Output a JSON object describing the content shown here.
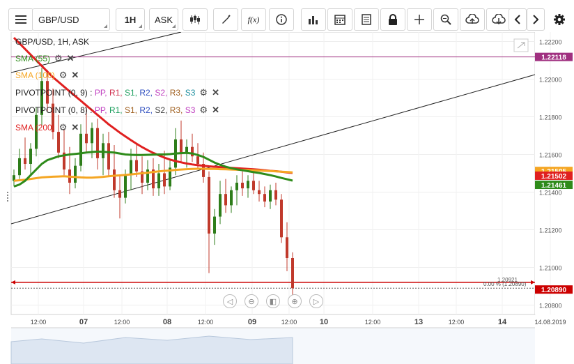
{
  "toolbar": {
    "symbol": "GBP/USD",
    "timeframe": "1H",
    "price_type": "ASK",
    "icons": [
      "menu-icon",
      "candle-type-icon",
      "draw-icon",
      "function-icon",
      "info-icon",
      "indicators-icon",
      "calendar-icon",
      "template-icon",
      "lock-icon",
      "crosshair-icon",
      "zoom-icon",
      "upload-icon",
      "download-icon",
      "left-arrow-icon",
      "right-arrow-icon",
      "settings-icon"
    ],
    "fx_label": "f(x)"
  },
  "legend": {
    "title": "GBP/USD, 1H, ASK",
    "sma55": "SMA (55)",
    "sma100": "SMA (100)",
    "pivot1_name": "PIVOTPOINT (0, 9)",
    "pivot2_name": "PIVOTPOINT (0, 8)",
    "sma200": "SMA (200)",
    "pivot_sep": " : ",
    "pivot_items": [
      {
        "label": "PP",
        "color": "#c040c0"
      },
      {
        "label": "R1",
        "color": "#d03050"
      },
      {
        "label": "S1",
        "color": "#20a060"
      },
      {
        "label": "R2",
        "color": "#3050c0"
      },
      {
        "label": "S2",
        "color": "#c040c0"
      },
      {
        "label": "R3",
        "color": "#a06020"
      },
      {
        "label": "S3",
        "color": "#2090a0"
      }
    ],
    "pivot2_items": [
      {
        "label": "PP",
        "color": "#c040c0"
      },
      {
        "label": "R1",
        "color": "#20a060"
      },
      {
        "label": "S1",
        "color": "#a06020"
      },
      {
        "label": "R2",
        "color": "#3050c0"
      },
      {
        "label": "S2",
        "color": "#444444"
      },
      {
        "label": "R3",
        "color": "#a06020"
      },
      {
        "label": "S3",
        "color": "#c040c0"
      }
    ]
  },
  "colors": {
    "sma55": "#2e8b1a",
    "sma100": "#f5a623",
    "sma200": "#e02020",
    "bull": "#2e7d1a",
    "bear": "#c0392b",
    "pivot_line": "#a03080",
    "hline": "#cc0000"
  },
  "price_labels": {
    "pivot_top": "1.22118",
    "last": "1.20890",
    "sma100_val": "1.21505",
    "sma200_val": "1.21502",
    "sma55_val": "1.21461",
    "line_note": "0.00 % (1.20890)",
    "line_note2": "1.20921"
  },
  "chart_data": {
    "type": "candlestick",
    "title": "GBP/USD, 1H, ASK",
    "ylim": [
      1.2075,
      1.2225
    ],
    "y_ticks": [
      "1.22200",
      "1.22000",
      "1.21800",
      "1.21600",
      "1.21400",
      "1.21200",
      "1.21000",
      "1.20800"
    ],
    "x_ticks": [
      "12:00",
      "07",
      "12:00",
      "08",
      "12:00",
      "09",
      "12:00",
      "10",
      "12:00",
      "13",
      "12:00",
      "14",
      "14.08.2019"
    ],
    "horizontal_levels": {
      "pivot": 1.22118,
      "last": 1.2089,
      "marker": 1.20921
    },
    "sma_values_last": {
      "SMA (100)": 1.21505,
      "SMA (200)": 1.21502,
      "SMA (55)": 1.21461
    },
    "candles": [
      {
        "o": 1.2146,
        "h": 1.2152,
        "l": 1.2143,
        "c": 1.2149
      },
      {
        "o": 1.2149,
        "h": 1.2163,
        "l": 1.2147,
        "c": 1.2158
      },
      {
        "o": 1.2158,
        "h": 1.2169,
        "l": 1.2152,
        "c": 1.2155
      },
      {
        "o": 1.2155,
        "h": 1.2166,
        "l": 1.2149,
        "c": 1.2163
      },
      {
        "o": 1.2163,
        "h": 1.2185,
        "l": 1.2159,
        "c": 1.2181
      },
      {
        "o": 1.2181,
        "h": 1.2206,
        "l": 1.2175,
        "c": 1.2199
      },
      {
        "o": 1.2199,
        "h": 1.2205,
        "l": 1.2183,
        "c": 1.2187
      },
      {
        "o": 1.2187,
        "h": 1.2195,
        "l": 1.2168,
        "c": 1.2172
      },
      {
        "o": 1.2172,
        "h": 1.2181,
        "l": 1.2158,
        "c": 1.2161
      },
      {
        "o": 1.2161,
        "h": 1.2173,
        "l": 1.2149,
        "c": 1.2152
      },
      {
        "o": 1.2152,
        "h": 1.2164,
        "l": 1.2139,
        "c": 1.2145
      },
      {
        "o": 1.2145,
        "h": 1.2158,
        "l": 1.2142,
        "c": 1.2154
      },
      {
        "o": 1.2154,
        "h": 1.2176,
        "l": 1.2151,
        "c": 1.2171
      },
      {
        "o": 1.2171,
        "h": 1.2185,
        "l": 1.2161,
        "c": 1.2166
      },
      {
        "o": 1.2166,
        "h": 1.2177,
        "l": 1.2158,
        "c": 1.2174
      },
      {
        "o": 1.2174,
        "h": 1.2179,
        "l": 1.2152,
        "c": 1.2158
      },
      {
        "o": 1.2158,
        "h": 1.2171,
        "l": 1.2149,
        "c": 1.2166
      },
      {
        "o": 1.2166,
        "h": 1.2172,
        "l": 1.2148,
        "c": 1.2152
      },
      {
        "o": 1.2152,
        "h": 1.2165,
        "l": 1.2137,
        "c": 1.2141
      },
      {
        "o": 1.2141,
        "h": 1.2149,
        "l": 1.2126,
        "c": 1.2137
      },
      {
        "o": 1.2137,
        "h": 1.2152,
        "l": 1.2134,
        "c": 1.2149
      },
      {
        "o": 1.2149,
        "h": 1.2163,
        "l": 1.2141,
        "c": 1.2157
      },
      {
        "o": 1.2157,
        "h": 1.2166,
        "l": 1.2148,
        "c": 1.2151
      },
      {
        "o": 1.2151,
        "h": 1.2159,
        "l": 1.2139,
        "c": 1.2145
      },
      {
        "o": 1.2145,
        "h": 1.2157,
        "l": 1.2141,
        "c": 1.2152
      },
      {
        "o": 1.2152,
        "h": 1.2158,
        "l": 1.2138,
        "c": 1.2142
      },
      {
        "o": 1.2142,
        "h": 1.2155,
        "l": 1.2138,
        "c": 1.215
      },
      {
        "o": 1.215,
        "h": 1.2162,
        "l": 1.2139,
        "c": 1.2143
      },
      {
        "o": 1.2143,
        "h": 1.2157,
        "l": 1.2141,
        "c": 1.2153
      },
      {
        "o": 1.2153,
        "h": 1.2174,
        "l": 1.2149,
        "c": 1.2168
      },
      {
        "o": 1.2168,
        "h": 1.2178,
        "l": 1.2156,
        "c": 1.2161
      },
      {
        "o": 1.2161,
        "h": 1.2168,
        "l": 1.2153,
        "c": 1.2164
      },
      {
        "o": 1.2164,
        "h": 1.2171,
        "l": 1.2156,
        "c": 1.2159
      },
      {
        "o": 1.2159,
        "h": 1.2166,
        "l": 1.2152,
        "c": 1.2155
      },
      {
        "o": 1.2155,
        "h": 1.2161,
        "l": 1.2145,
        "c": 1.2148
      },
      {
        "o": 1.2148,
        "h": 1.2151,
        "l": 1.2097,
        "c": 1.2118
      },
      {
        "o": 1.2118,
        "h": 1.2131,
        "l": 1.2112,
        "c": 1.2127
      },
      {
        "o": 1.2127,
        "h": 1.2146,
        "l": 1.2123,
        "c": 1.2139
      },
      {
        "o": 1.2139,
        "h": 1.2147,
        "l": 1.2129,
        "c": 1.2133
      },
      {
        "o": 1.2133,
        "h": 1.2143,
        "l": 1.2129,
        "c": 1.2141
      },
      {
        "o": 1.2141,
        "h": 1.2149,
        "l": 1.2133,
        "c": 1.2145
      },
      {
        "o": 1.2145,
        "h": 1.2151,
        "l": 1.2138,
        "c": 1.2142
      },
      {
        "o": 1.2142,
        "h": 1.2149,
        "l": 1.2137,
        "c": 1.2146
      },
      {
        "o": 1.2146,
        "h": 1.2151,
        "l": 1.2139,
        "c": 1.2141
      },
      {
        "o": 1.2141,
        "h": 1.2146,
        "l": 1.2135,
        "c": 1.2139
      },
      {
        "o": 1.2139,
        "h": 1.2143,
        "l": 1.2132,
        "c": 1.2135
      },
      {
        "o": 1.2135,
        "h": 1.2144,
        "l": 1.2131,
        "c": 1.2141
      },
      {
        "o": 1.2141,
        "h": 1.2145,
        "l": 1.2133,
        "c": 1.2136
      },
      {
        "o": 1.2136,
        "h": 1.2139,
        "l": 1.2113,
        "c": 1.2116
      },
      {
        "o": 1.2116,
        "h": 1.2124,
        "l": 1.2098,
        "c": 1.2105
      },
      {
        "o": 1.2105,
        "h": 1.2108,
        "l": 1.2079,
        "c": 1.2089
      }
    ],
    "sma55": [
      1.2143,
      1.2144,
      1.2146,
      1.2149,
      1.2152,
      1.2155,
      1.2157,
      1.2158,
      1.2159,
      1.21595,
      1.216,
      1.21603,
      1.21606,
      1.2161,
      1.21613,
      1.21615,
      1.21614,
      1.21612,
      1.2161,
      1.21605,
      1.216,
      1.21598,
      1.21597,
      1.21597,
      1.21598,
      1.21599,
      1.216,
      1.216,
      1.21602,
      1.21605,
      1.21607,
      1.21608,
      1.21605,
      1.21597,
      1.21587,
      1.21572,
      1.21557,
      1.21545,
      1.21535,
      1.21527,
      1.21521,
      1.21516,
      1.21511,
      1.21506,
      1.21502,
      1.21496,
      1.2149,
      1.21483,
      1.21475,
      1.21468,
      1.21461
    ],
    "sma100": [
      1.2146,
      1.21463,
      1.21466,
      1.2147,
      1.21474,
      1.21478,
      1.2148,
      1.21482,
      1.21483,
      1.21484,
      1.21482,
      1.2148,
      1.21478,
      1.21477,
      1.21477,
      1.21479,
      1.21481,
      1.21484,
      1.21487,
      1.21489,
      1.21491,
      1.21494,
      1.21497,
      1.215,
      1.21503,
      1.21507,
      1.2151,
      1.21513,
      1.21515,
      1.21518,
      1.2152,
      1.21522,
      1.21523,
      1.21524,
      1.21524,
      1.21523,
      1.21523,
      1.21522,
      1.21521,
      1.2152,
      1.21519,
      1.21518,
      1.21517,
      1.21516,
      1.21515,
      1.21513,
      1.21512,
      1.2151,
      1.21508,
      1.21507,
      1.21505
    ],
    "sma200": [
      1.2222,
      1.2219,
      1.2216,
      1.2213,
      1.221,
      1.2207,
      1.2204,
      1.2201,
      1.21985,
      1.2196,
      1.21935,
      1.2191,
      1.21885,
      1.2186,
      1.21835,
      1.2181,
      1.21785,
      1.2176,
      1.21738,
      1.21716,
      1.21696,
      1.21676,
      1.21657,
      1.21639,
      1.21623,
      1.21608,
      1.21595,
      1.21583,
      1.21573,
      1.21565,
      1.21558,
      1.21552,
      1.21547,
      1.21543,
      1.2154,
      1.21537,
      1.21535,
      1.21533,
      1.21531,
      1.21529,
      1.21527,
      1.21525,
      1.21523,
      1.21521,
      1.21519,
      1.21516,
      1.21513,
      1.21511,
      1.21508,
      1.21505,
      1.21502
    ]
  }
}
